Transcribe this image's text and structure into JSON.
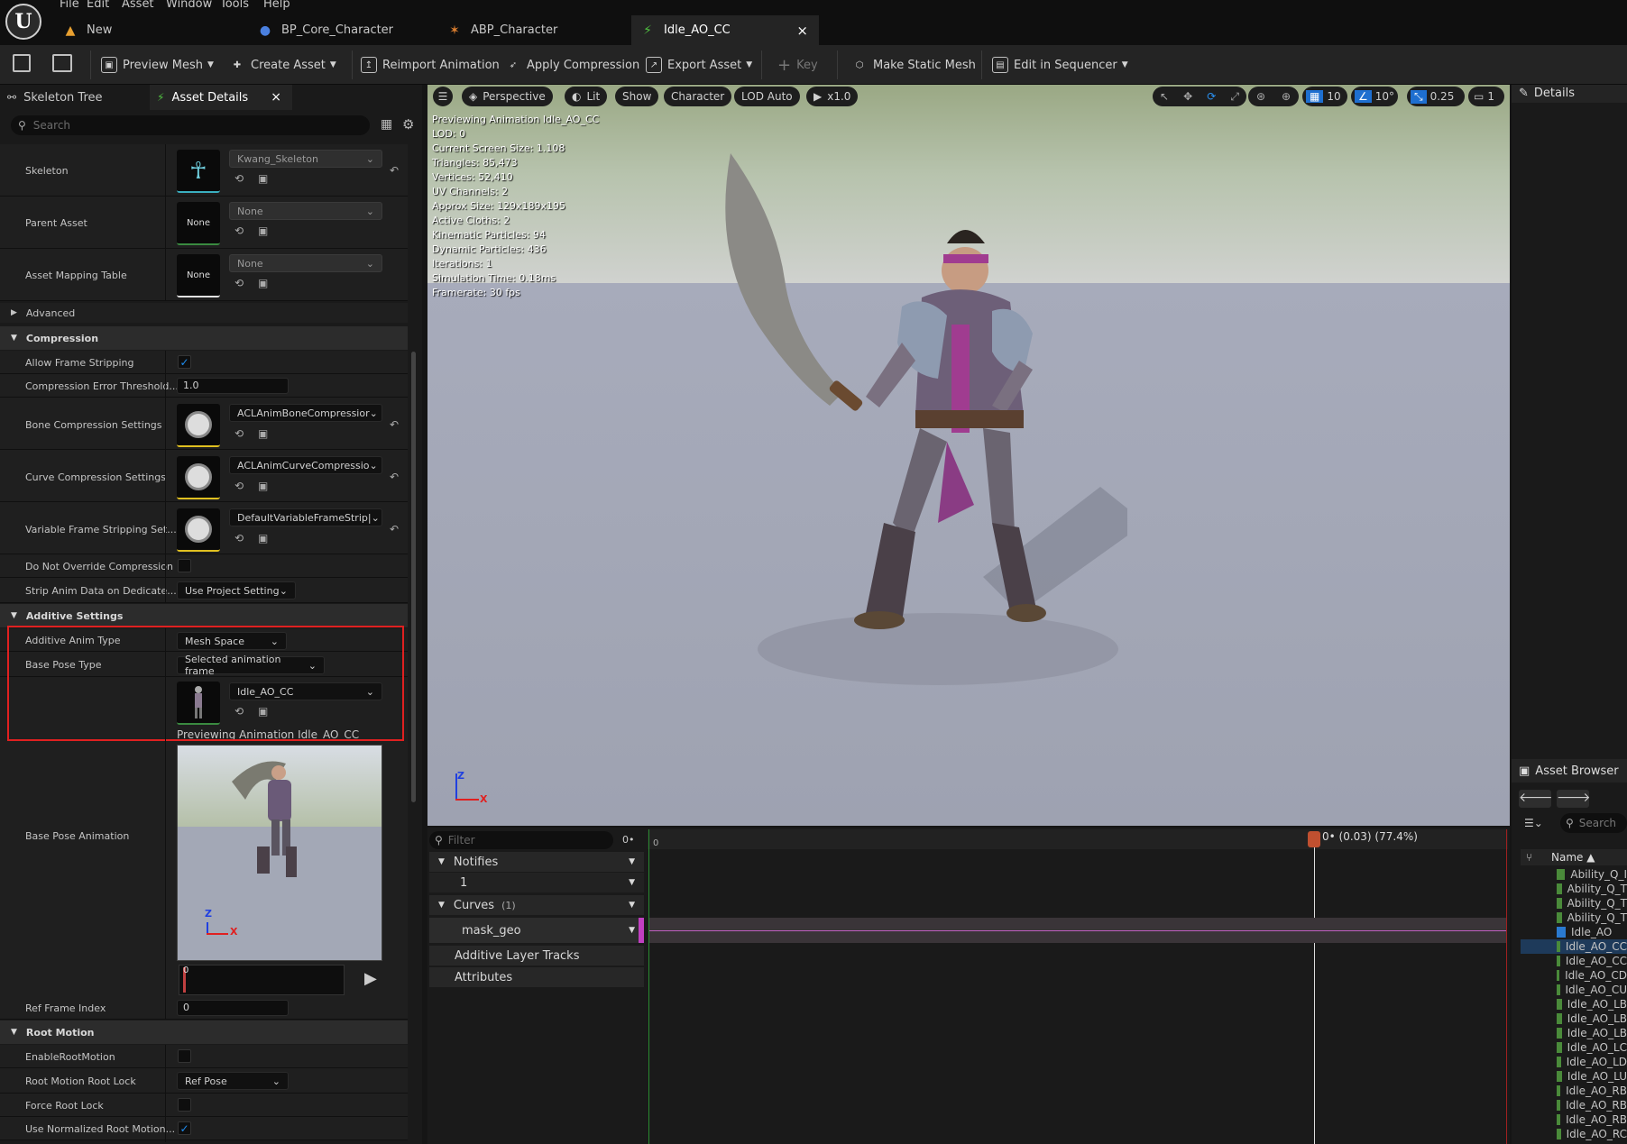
{
  "menu": [
    "File",
    "Edit",
    "Asset",
    "Window",
    "Tools",
    "Help"
  ],
  "tabs": [
    {
      "label": "New",
      "icon": "flame-icon"
    },
    {
      "label": "BP_Core_Character",
      "icon": "person-icon"
    },
    {
      "label": "ABP_Character",
      "icon": "anim-blueprint-icon"
    },
    {
      "label": "Idle_AO_CC",
      "icon": "animation-icon",
      "close": "×"
    }
  ],
  "toolbar": {
    "preview_mesh": "Preview Mesh",
    "create_asset": "Create Asset",
    "reimport": "Reimport Animation",
    "apply_compression": "Apply Compression",
    "export_asset": "Export Asset",
    "key": "Key",
    "make_static_mesh": "Make Static Mesh",
    "edit_in_sequencer": "Edit in Sequencer"
  },
  "left_tabs": {
    "skeleton_tree": "Skeleton Tree",
    "asset_details": "Asset Details",
    "close": "×"
  },
  "search_placeholder": "Search",
  "props": {
    "skeleton_label": "Skeleton",
    "skeleton_value": "Kwang_Skeleton",
    "parent_label": "Parent Asset",
    "parent_value": "None",
    "parent_thumb": "None",
    "mapping_label": "Asset Mapping Table",
    "mapping_value": "None",
    "mapping_thumb": "None",
    "advanced": "Advanced",
    "compression": "Compression",
    "allow_frame_stripping": "Allow Frame Stripping",
    "comp_error": "Compression Error Threshold...",
    "comp_error_value": "1.0",
    "bone_comp": "Bone Compression Settings",
    "bone_comp_value": "ACLAnimBoneCompressior",
    "curve_comp": "Curve Compression Settings",
    "curve_comp_value": "ACLAnimCurveCompressio",
    "var_frame": "Variable Frame Stripping Set...",
    "var_frame_value": "DefaultVariableFrameStrip|",
    "no_override": "Do Not Override Compression",
    "strip_anim": "Strip Anim Data on Dedicate...",
    "strip_anim_value": "Use Project Setting",
    "additive": "Additive Settings",
    "additive_type": "Additive Anim Type",
    "additive_type_value": "Mesh Space",
    "base_pose_type": "Base Pose Type",
    "base_pose_type_value": "Selected animation frame",
    "base_anim_value": "Idle_AO_CC",
    "previewing": "Previewing Animation Idle_AO_CC",
    "base_pose_anim": "Base Pose Animation",
    "mini_frame": "0",
    "ref_frame": "Ref Frame Index",
    "ref_frame_value": "0",
    "root_motion": "Root Motion",
    "enable_root": "EnableRootMotion",
    "root_lock": "Root Motion Root Lock",
    "root_lock_value": "Ref Pose",
    "force_root": "Force Root Lock",
    "normalized": "Use Normalized Root Motion..."
  },
  "viewport": {
    "perspective": "Perspective",
    "lit": "Lit",
    "show": "Show",
    "character": "Character",
    "lod": "LOD Auto",
    "speed": "x1.0",
    "grid": "10",
    "angle": "10°",
    "scale": "0.25",
    "cam": "1",
    "stats": [
      "Previewing Animation Idle_AO_CC",
      "LOD: 0",
      "Current Screen Size: 1.108",
      "Triangles: 85,473",
      "Vertices: 52,410",
      "UV Channels: 2",
      "Approx Size: 129x189x195",
      "Active Cloths: 2",
      "Kinematic Particles: 94",
      "Dynamic Particles: 436",
      "Iterations: 1",
      "Simulation Time: 0.18ms",
      "Framerate: 30 fps"
    ],
    "axis_z": "Z",
    "axis_x": "X"
  },
  "details_title": "Details",
  "asset_browser": {
    "title": "Asset Browser",
    "search": "Search",
    "name_col": "Name",
    "items": [
      "Ability_Q_I",
      "Ability_Q_T",
      "Ability_Q_T",
      "Ability_Q_T",
      "Idle_AO",
      "Idle_AO_CC",
      "Idle_AO_CC",
      "Idle_AO_CD",
      "Idle_AO_CU",
      "Idle_AO_LB",
      "Idle_AO_LB",
      "Idle_AO_LB",
      "Idle_AO_LC",
      "Idle_AO_LD",
      "Idle_AO_LU",
      "Idle_AO_RB",
      "Idle_AO_RB",
      "Idle_AO_RB",
      "Idle_AO_RC"
    ]
  },
  "timeline": {
    "filter": "Filter",
    "zero": "0",
    "playhead": "0• (0.03) (77.4%)",
    "notifies": "Notifies",
    "notify_track": "1",
    "curves": "Curves",
    "curves_count": "(1)",
    "mask_geo": "mask_geo",
    "additive_layers": "Additive Layer Tracks",
    "attributes": "Attributes"
  },
  "colors": {
    "accent": "#1e8df0",
    "highlight_box": "#e02020",
    "playhead": "#c05030"
  }
}
